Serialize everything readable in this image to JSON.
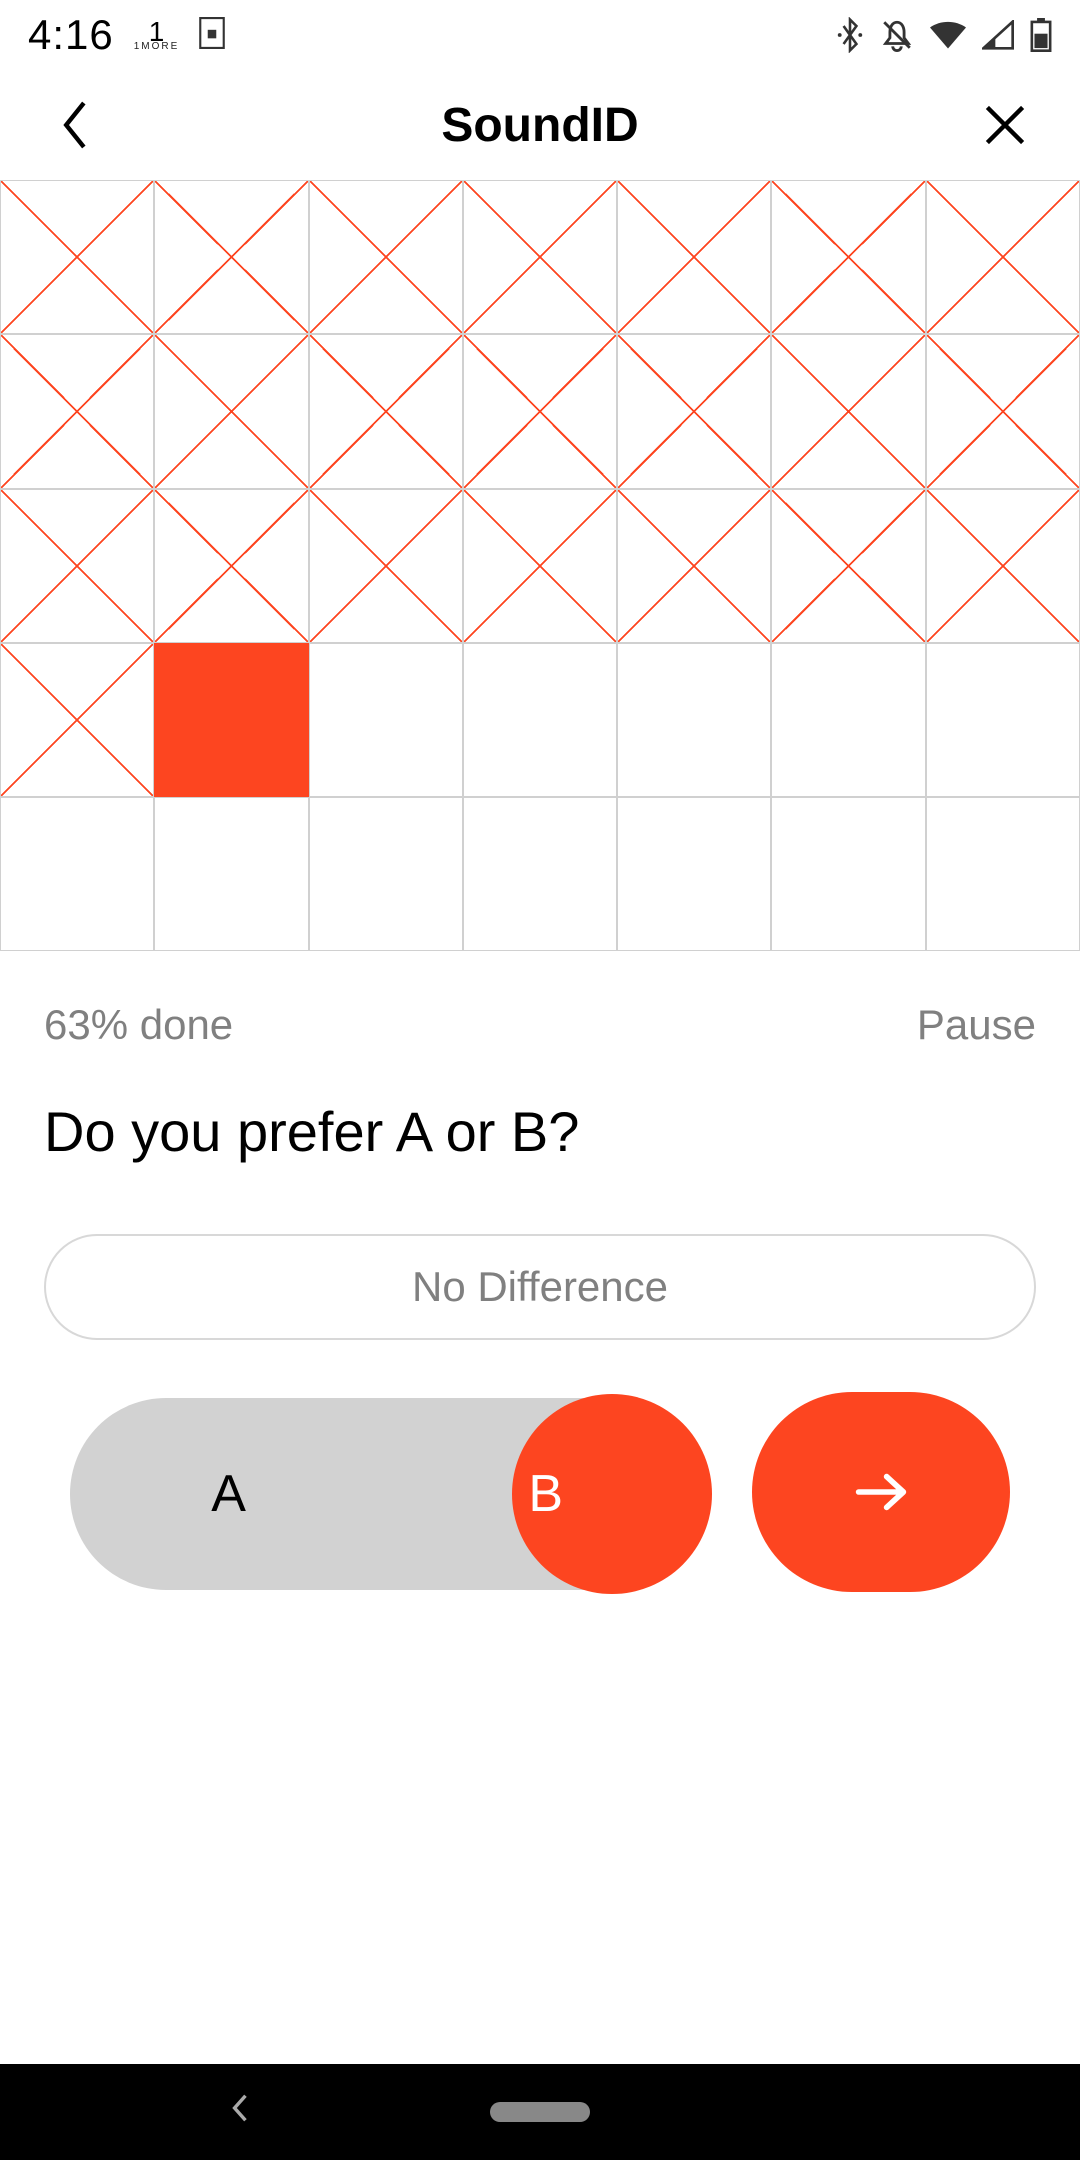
{
  "status": {
    "time": "4:16",
    "brand_num": "1",
    "brand_label": "1MORE"
  },
  "header": {
    "title": "SoundID"
  },
  "grid": {
    "cols": 7,
    "rows": 5,
    "cells": [
      "x",
      "x",
      "x",
      "x",
      "x",
      "x",
      "x",
      "x",
      "x",
      "x",
      "x",
      "x",
      "x",
      "x",
      "x",
      "x",
      "x",
      "x",
      "x",
      "x",
      "x",
      "x",
      "f",
      "e",
      "e",
      "e",
      "e",
      "e",
      "e",
      "e",
      "e",
      "e",
      "e",
      "e",
      "e"
    ]
  },
  "progress": {
    "label": "63% done",
    "pause_label": "Pause"
  },
  "question": {
    "text": "Do you prefer A or B?"
  },
  "buttons": {
    "no_difference": "No Difference",
    "option_a": "A",
    "option_b": "B",
    "selected": "B"
  },
  "colors": {
    "accent": "#fd4520"
  }
}
